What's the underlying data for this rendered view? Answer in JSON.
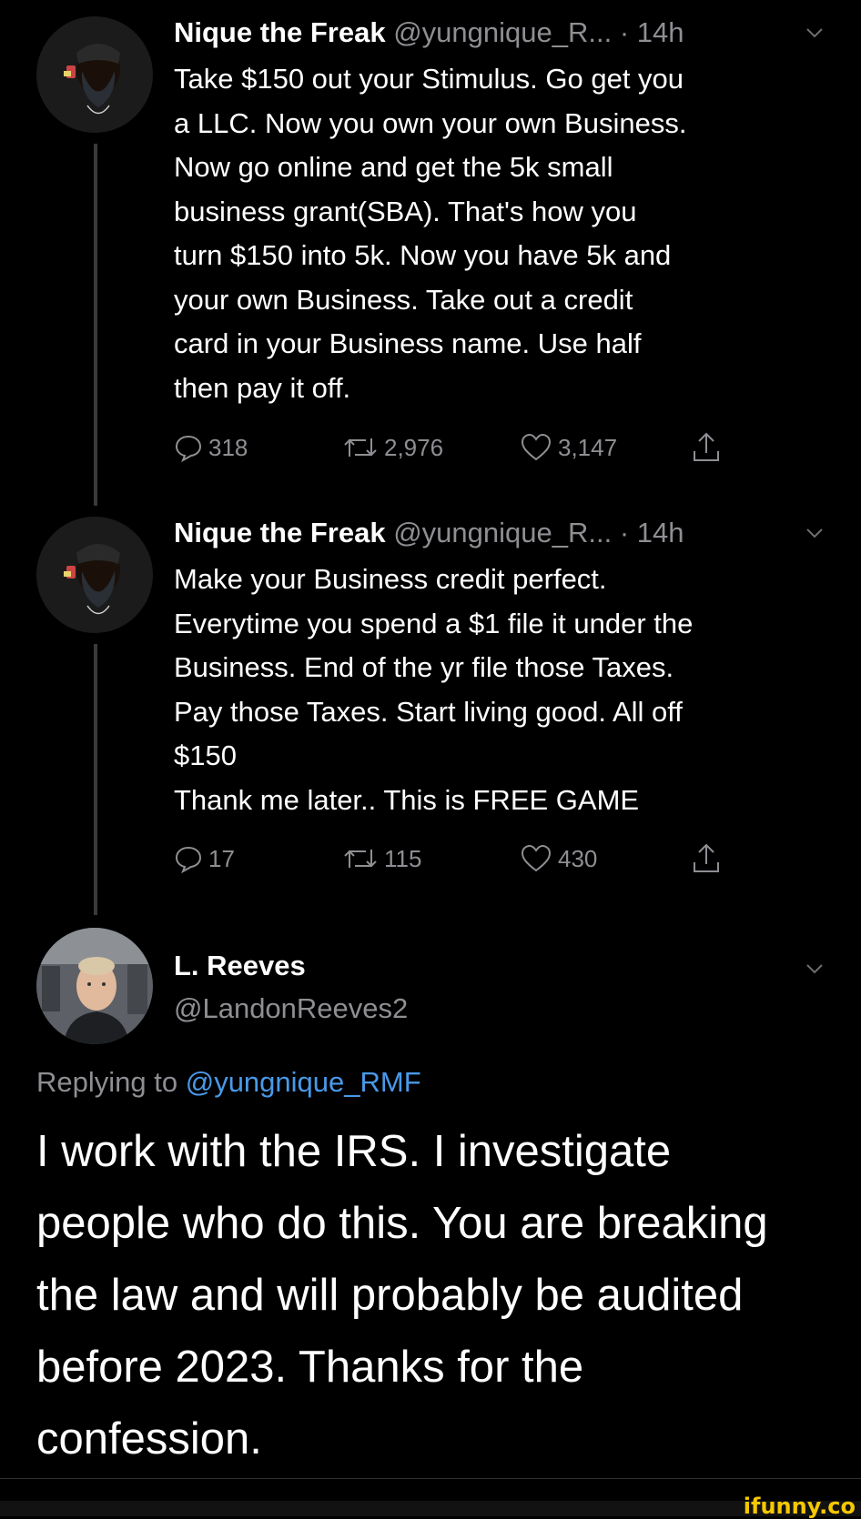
{
  "tweet1": {
    "name": "Nique the Freak",
    "handle": "@yungnique_R...",
    "dot": "·",
    "time": "14h",
    "text": "Take $150 out your Stimulus. Go get you\na LLC. Now you own your own Business.\nNow go online and get the 5k small\nbusiness grant(SBA). That's how you\nturn $150 into 5k. Now you have 5k and\nyour own Business. Take out a credit\ncard in your Business name. Use half\nthen pay it off.",
    "replies": "318",
    "retweets": "2,976",
    "likes": "3,147"
  },
  "tweet2": {
    "name": "Nique the Freak",
    "handle": "@yungnique_R...",
    "dot": "·",
    "time": "14h",
    "text": "Make your Business credit perfect.\nEverytime you spend a $1 file it under the\nBusiness. End of the yr file those Taxes.\nPay those Taxes. Start living good. All off\n$150\nThank me later.. This is FREE GAME",
    "replies": "17",
    "retweets": "115",
    "likes": "430"
  },
  "main_tweet": {
    "name": "L. Reeves",
    "handle": "@LandonReeves2",
    "replying_prefix": "Replying to ",
    "replying_to": "@yungnique_RMF",
    "text": "I work with the IRS. I investigate\npeople who do this. You are breaking\nthe law and will probably be audited\nbefore 2023. Thanks for the\nconfession."
  },
  "watermark": "ifunny.co",
  "colors": {
    "background": "#000000",
    "text": "#ffffff",
    "secondary": "#8e8e93",
    "link": "#4a99e9",
    "watermark": "#f5c800"
  },
  "icons": [
    "reply-icon",
    "retweet-icon",
    "like-icon",
    "share-icon",
    "chevron-down-icon"
  ]
}
